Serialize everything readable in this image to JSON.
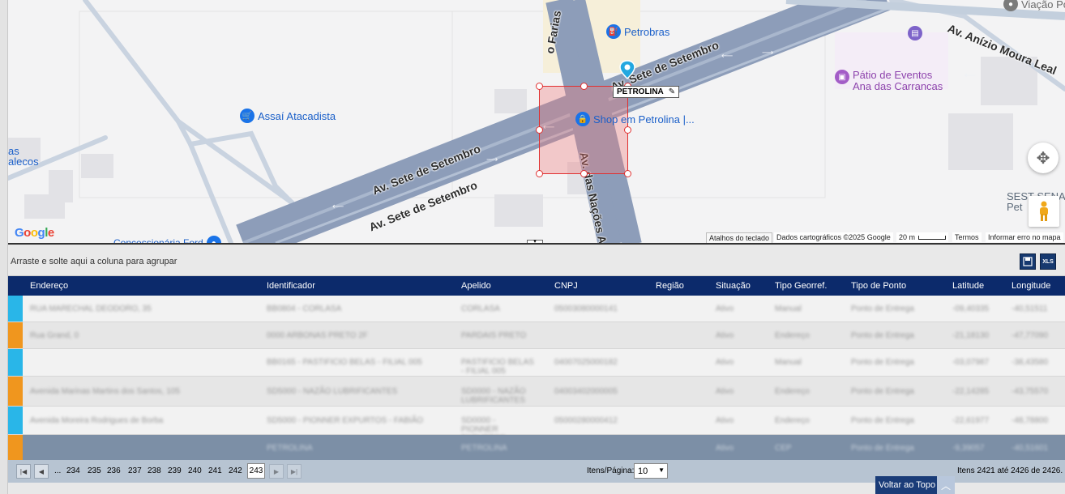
{
  "map": {
    "pois": {
      "petrobras": "Petrobras",
      "assai": "Assaí Atacadista",
      "patio": "Pátio de Eventos\nAna das Carrancas",
      "shop": "Shop em Petrolina |...",
      "viacao": "Viação Po",
      "concessionaria": "Concessionária Ford",
      "sest": "SEST SENAT\nPet",
      "ecos": "as\nalecos"
    },
    "roads": {
      "sete_setembro_1": "Av. Sete de Setembro",
      "sete_setembro_2": "Av. Sete de Setembro",
      "sete_setembro_3": "Av. Sete de Setembro",
      "anizio": "Av. Anízio Moura Leal",
      "farias": "o Farias",
      "nacoes": "Av. das Nações A"
    },
    "marker_label": "PETROLINA",
    "google": "Google",
    "attribution": {
      "shortcuts": "Atalhos do teclado",
      "data": "Dados cartográficos ©2025 Google",
      "scale": "20 m",
      "terms": "Termos",
      "report": "Informar erro no mapa"
    },
    "icons": [
      "fuel-icon",
      "shopping-cart-icon",
      "event-icon",
      "lock-icon",
      "bus-icon",
      "map-pin-icon",
      "move-icon",
      "pegman-icon",
      "pencil-icon"
    ]
  },
  "groupbar": {
    "hint": "Arraste e solte aqui a coluna para agrupar",
    "btn_save": "💾",
    "btn_excel": "XLS"
  },
  "grid": {
    "columns": [
      "Endereço",
      "Identificador",
      "Apelido",
      "CNPJ",
      "Região",
      "Situação",
      "Tipo Georref.",
      "Tipo de Ponto",
      "Latitude",
      "Longitude"
    ],
    "rows": [
      {
        "marker": "#29b6e8",
        "cells": [
          "RUA MARECHAL DEODORO, 35",
          "BB0804 - CORLASA",
          "CORLASA",
          "05003080000141",
          "",
          "Ativo",
          "Manual",
          "Ponto de Entrega",
          "-09,40335",
          "-40,51511"
        ]
      },
      {
        "marker": "#f0961e",
        "cells": [
          "Rua Grand, 0",
          "0000 ARBONAS PRETO 2F",
          "PARDAIS PRETO",
          "",
          "",
          "Ativo",
          "Endereço",
          "Ponto de Entrega",
          "-21,18130",
          "-47,77090"
        ]
      },
      {
        "marker": "#29b6e8",
        "cells": [
          "",
          "BB0165 - PASTIFICIO BELAS - FILIAL 005",
          "PASTIFICIO BELAS - FILIAL 005",
          "04007025000182",
          "",
          "Ativo",
          "Manual",
          "Ponto de Entrega",
          "-03,07987",
          "-38,43580"
        ]
      },
      {
        "marker": "#f0961e",
        "cells": [
          "Avenida Marinas Martins dos Santos, 105",
          "SD5000 - NAZÃO LUBRIFICANTES",
          "SD0000 - NAZÃO LUBRIFICANTES",
          "04003402000005",
          "",
          "Ativo",
          "Endereço",
          "Ponto de Entrega",
          "-22,14285",
          "-43,75570"
        ]
      },
      {
        "marker": "#29b6e8",
        "cells": [
          "Avenida Moreira Rodrigues de Borba",
          "SD5000 - PIONNER EXPURTOS - FABIÃO",
          "SD0000 - PIONNER EXPURTOS - FABIÃO",
          "05000280000412",
          "",
          "Ativo",
          "Endereço",
          "Ponto de Entrega",
          "-22,61977",
          "-48,78800"
        ]
      },
      {
        "marker": "#f0961e",
        "cells": [
          "",
          "PETROLINA",
          "PETROLINA",
          "",
          "",
          "Ativo",
          "CEP",
          "Ponto de Entrega",
          "-9,39057",
          "-40,51601"
        ]
      }
    ]
  },
  "pager": {
    "pages": [
      "234",
      "235",
      "236",
      "237",
      "238",
      "239",
      "240",
      "241",
      "242"
    ],
    "current": "243",
    "ellipsis": "...",
    "items_label": "Itens/Página:",
    "items_value": "10",
    "summary": "Itens 2421 até 2426 de 2426.",
    "back_to_top": "Voltar ao Topo"
  }
}
